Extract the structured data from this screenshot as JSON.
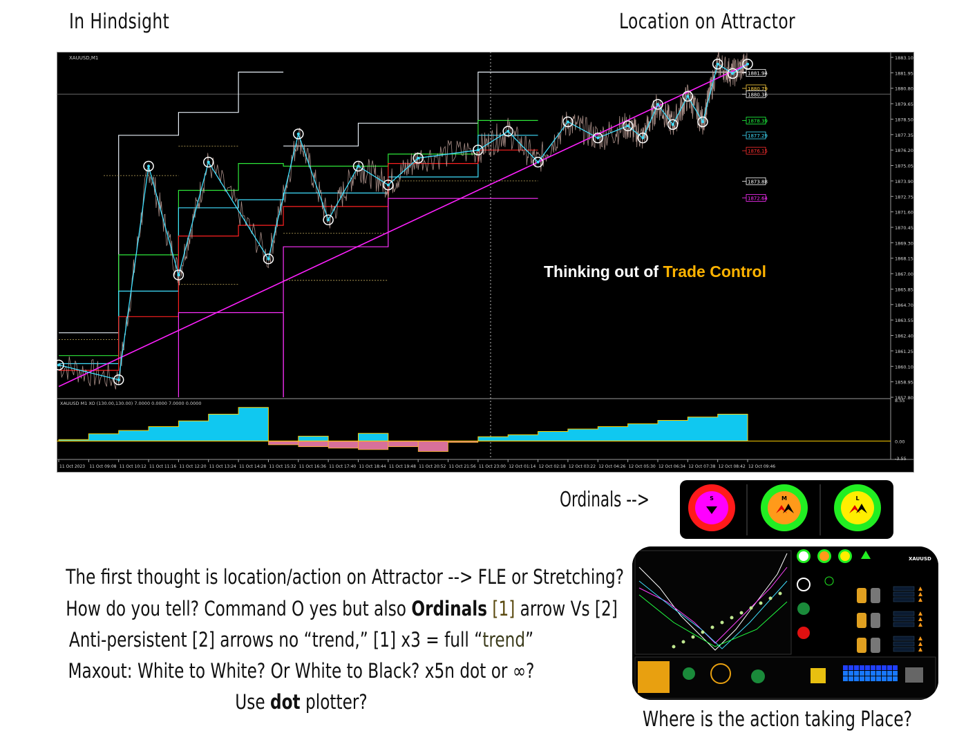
{
  "header": {
    "left": "In Hindsight",
    "right": "Location on Attractor"
  },
  "chart_data": {
    "type": "line",
    "title": "XAUUSD,M1",
    "subtitle": "XAUUSD M1 XO (130.00,130.00) 7.0000 0.0000 7.0000 0.0000",
    "ylim": [
      1857.8,
      1883.1
    ],
    "y_ticks": [
      "1883.10",
      "1881.95",
      "1880.80",
      "1879.65",
      "1878.50",
      "1877.35",
      "1876.20",
      "1875.05",
      "1873.90",
      "1872.75",
      "1871.60",
      "1870.45",
      "1869.30",
      "1868.15",
      "1867.00",
      "1865.85",
      "1864.70",
      "1863.55",
      "1862.40",
      "1861.25",
      "1860.10",
      "1858.95",
      "1857.80"
    ],
    "x_ticks": [
      "11 Oct 2023",
      "11 Oct 09:08",
      "11 Oct 10:12",
      "11 Oct 11:16",
      "11 Oct 12:20",
      "11 Oct 13:24",
      "11 Oct 14:28",
      "11 Oct 15:32",
      "11 Oct 16:36",
      "11 Oct 17:40",
      "11 Oct 18:44",
      "11 Oct 19:48",
      "11 Oct 20:52",
      "11 Oct 21:56",
      "11 Oct 23:00",
      "12 Oct 01:14",
      "12 Oct 02:18",
      "12 Oct 03:22",
      "12 Oct 04:26",
      "12 Oct 05:30",
      "12 Oct 06:34",
      "12 Oct 07:38",
      "12 Oct 08:42",
      "12 Oct 09:46"
    ],
    "price_labels": [
      {
        "text": "1881.94",
        "price": 1881.94,
        "color": "#ffffff"
      },
      {
        "text": "1880.79",
        "price": 1880.79,
        "color": "#ffd040"
      },
      {
        "text": "1880.36",
        "price": 1880.36,
        "color": "#ffffff"
      },
      {
        "text": "1878.39",
        "price": 1878.39,
        "color": "#20ff40"
      },
      {
        "text": "1877.29",
        "price": 1877.29,
        "color": "#40e0ff"
      },
      {
        "text": "1876.15",
        "price": 1876.15,
        "color": "#ff3030"
      },
      {
        "text": "1873.88",
        "price": 1873.88,
        "color": "#ffffff"
      },
      {
        "text": "1872.64",
        "price": 1872.64,
        "color": "#ff30ff"
      }
    ],
    "zigzag": {
      "x": [
        0,
        2,
        3,
        4,
        5,
        7,
        8,
        9,
        10,
        11,
        12,
        14,
        15,
        16,
        17,
        18,
        19,
        19.5,
        20,
        20.5,
        21,
        21.5,
        22,
        22.5,
        23
      ],
      "y": [
        1860.2,
        1859.1,
        1875.0,
        1866.9,
        1875.3,
        1868.1,
        1877.4,
        1871.0,
        1875.0,
        1873.6,
        1875.6,
        1876.2,
        1877.6,
        1875.3,
        1878.3,
        1877.1,
        1878.0,
        1877.1,
        1879.6,
        1878.1,
        1880.2,
        1878.3,
        1882.6,
        1881.9,
        1882.6
      ],
      "color": "#40e0ff"
    },
    "attractor_line": {
      "x": [
        0,
        23
      ],
      "y": [
        1858.6,
        1882.6
      ],
      "color": "#ff20ff"
    },
    "oscillator": {
      "ylim": [
        -3.55,
        8.55
      ],
      "y_ticks": [
        "8.55",
        "0.00",
        "-3.55"
      ]
    }
  },
  "overlay_text": {
    "thinking_prefix": "Thinking out of ",
    "thinking_highlight": "Trade Control"
  },
  "ordinals": {
    "label": "Ordinals -->",
    "items": [
      {
        "letter": "S",
        "outer": "#ff1a1a",
        "inner": "#ff00ff"
      },
      {
        "letter": "M",
        "outer": "#22ee22",
        "inner": "#ff9a1a"
      },
      {
        "letter": "L",
        "outer": "#22ee22",
        "inner": "#ffee00"
      }
    ]
  },
  "questions": {
    "line1": "The first thought is location/action on Attractor --> FLE or Stretching?",
    "line2_a": "How do you tell? Command O yes but also ",
    "line2_b": "Ordinals",
    "line2_c": " [1] ",
    "line2_d": "arrow Vs [2]",
    "line3_a": "Anti-persistent [2] arrows no “trend,” [1] x3 = full “",
    "line3_b": "trend",
    "line3_c": "”",
    "line4": "Maxout: White to White? Or White to Black? x5n dot or ∞?",
    "line5_a": "Use ",
    "line5_b": "dot",
    "line5_c": " plotter?"
  },
  "thumbnail": {
    "symbol": "XAUUSD"
  },
  "footer": "Where is the action taking Place?"
}
